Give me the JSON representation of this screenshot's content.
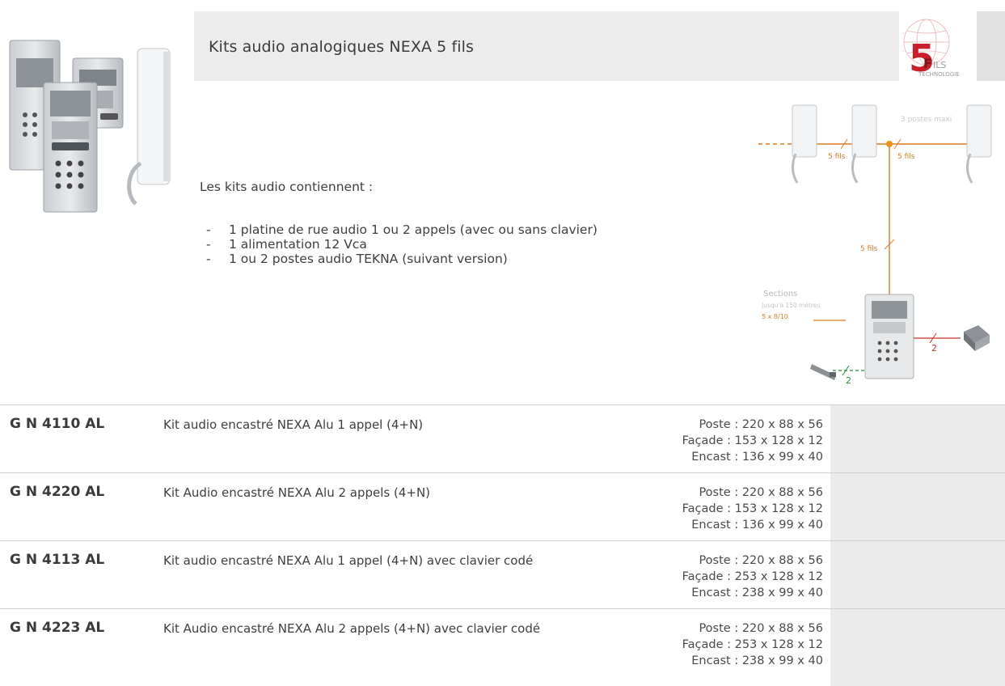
{
  "header": {
    "title": "Kits audio analogiques NEXA 5 fils",
    "logo_text": "5FILS TECHNOLOGIE"
  },
  "intro": {
    "heading": "Les kits audio contiennent :",
    "bullets": [
      "1 platine de rue audio 1 ou 2 appels (avec ou sans clavier)",
      "1 alimentation 12 Vca",
      "1 ou 2 postes audio TEKNA (suivant version)"
    ]
  },
  "diagram": {
    "max_label": "3 postes maxi",
    "wire_label": "5 fils",
    "sections_title": "Sections",
    "sections_distance": "Jusqu'à 150 mètres",
    "sections_value": "5 x 8/10",
    "count_two": "2"
  },
  "products": [
    {
      "code": "G N 4110 AL",
      "desc": "Kit audio encastré NEXA Alu 1 appel (4+N)",
      "poste": "Poste : 220 x 88 x 56",
      "facade": "Façade : 153 x 128 x 12",
      "encast": "Encast : 136 x 99 x 40"
    },
    {
      "code": "G N 4220 AL",
      "desc": "Kit Audio encastré NEXA Alu 2 appels (4+N)",
      "poste": "Poste : 220 x 88 x 56",
      "facade": "Façade : 153 x 128 x 12",
      "encast": "Encast : 136 x 99 x 40"
    },
    {
      "code": "G N 4113 AL",
      "desc": "Kit audio encastré NEXA Alu 1 appel (4+N) avec clavier codé",
      "poste": "Poste : 220 x 88 x 56",
      "facade": "Façade : 253 x 128 x 12",
      "encast": "Encast : 238 x 99 x 40"
    },
    {
      "code": "G N 4223 AL",
      "desc": "Kit Audio encastré NEXA Alu 2 appels (4+N) avec clavier codé",
      "poste": "Poste : 220 x 88 x 56",
      "facade": "Façade : 253 x 128 x 12",
      "encast": "Encast : 238 x 99 x 40"
    }
  ],
  "colors": {
    "header_band": "#ececec",
    "wire_orange": "#d97a22",
    "wire_red": "#c0392b",
    "wire_green": "#2e8b3a",
    "logo_red": "#c8202a"
  }
}
